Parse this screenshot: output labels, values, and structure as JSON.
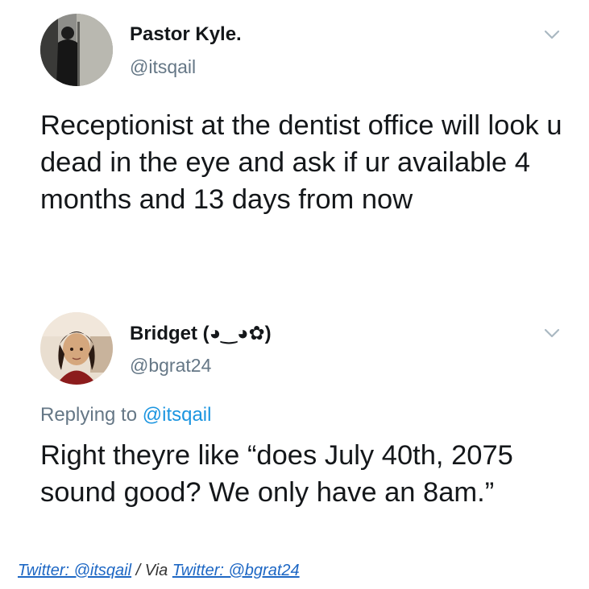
{
  "tweet1": {
    "name": "Pastor Kyle.",
    "handle": "@itsqail",
    "text": "Receptionist at the dentist office will look u dead in the eye and ask if ur available 4 months and 13 days from now"
  },
  "tweet2": {
    "name": "Bridget (◕‿◕✿)",
    "handle": "@bgrat24",
    "replying_prefix": "Replying to ",
    "replying_to": "@itsqail",
    "text": "Right theyre like “does July 40th, 2075 sound good? We only have an 8am.”"
  },
  "credits": {
    "link1": "Twitter: @itsqail",
    "separator": " / Via ",
    "link2": "Twitter: @bgrat24"
  },
  "colors": {
    "text": "#14171a",
    "secondary": "#657786",
    "mention": "#1b95e0",
    "credit_link": "#1d67c4"
  },
  "icons": {
    "menu": "chevron-down-icon"
  }
}
